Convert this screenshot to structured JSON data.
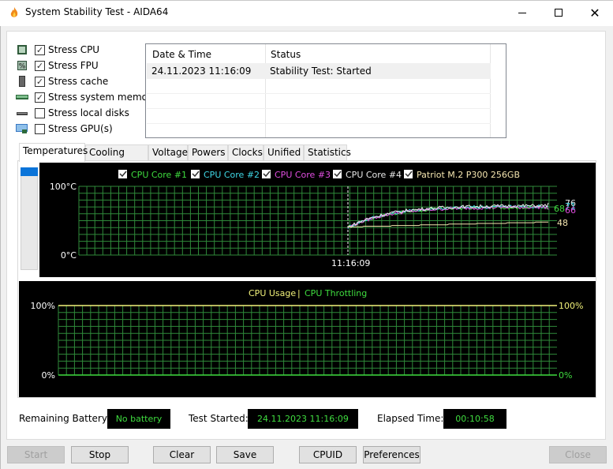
{
  "window": {
    "title": "System Stability Test - AIDA64",
    "controls": {
      "minimize": "—",
      "maximize": "☐",
      "close": "✕"
    }
  },
  "stress_options": [
    {
      "label": "Stress CPU",
      "checked": true,
      "icon": "cpu-icon"
    },
    {
      "label": "Stress FPU",
      "checked": true,
      "icon": "fpu-icon"
    },
    {
      "label": "Stress cache",
      "checked": true,
      "icon": "cache-icon"
    },
    {
      "label": "Stress system memory",
      "checked": true,
      "icon": "memory-icon"
    },
    {
      "label": "Stress local disks",
      "checked": false,
      "icon": "disk-icon"
    },
    {
      "label": "Stress GPU(s)",
      "checked": false,
      "icon": "gpu-icon"
    }
  ],
  "log": {
    "columns": [
      "Date & Time",
      "Status"
    ],
    "rows": [
      {
        "datetime": "24.11.2023 11:16:09",
        "status": "Stability Test: Started"
      }
    ]
  },
  "tabs": [
    "Temperatures",
    "Cooling Fans",
    "Voltages",
    "Powers",
    "Clocks",
    "Unified",
    "Statistics"
  ],
  "active_tab": "Temperatures",
  "chart_data": [
    {
      "type": "line",
      "title": "Temperatures",
      "ylabel": "°C",
      "ylim": [
        0,
        100
      ],
      "ytick_labels": [
        "100°C",
        "0°C"
      ],
      "xtick_labels": [
        "11:16:09"
      ],
      "marker_label": "11:16:09",
      "grid": true,
      "legend": "top",
      "series": [
        {
          "name": "CPU Core #1",
          "color": "#3fdc3f",
          "checked": true,
          "current": 68,
          "start": 40,
          "plateau": 70
        },
        {
          "name": "CPU Core #2",
          "color": "#3fd7e6",
          "checked": true,
          "current": 71,
          "start": 40,
          "plateau": 71
        },
        {
          "name": "CPU Core #3",
          "color": "#e04ee0",
          "checked": true,
          "current": 66,
          "start": 40,
          "plateau": 70
        },
        {
          "name": "CPU Core #4",
          "color": "#e8e8e8",
          "checked": true,
          "current": 76,
          "start": 40,
          "plateau": 72
        },
        {
          "name": "Patriot M.2 P300 256GB",
          "color": "#f5e6b0",
          "checked": true,
          "current": 48,
          "start": 38,
          "plateau": 48
        }
      ],
      "value_labels": [
        {
          "text": "76",
          "color": "#e8e8e8"
        },
        {
          "text": "71",
          "color": "#3fd7e6"
        },
        {
          "text": "68",
          "color": "#3fdc3f"
        },
        {
          "text": "66",
          "color": "#e04ee0"
        },
        {
          "text": "48",
          "color": "#f5e6b0"
        }
      ]
    },
    {
      "type": "line",
      "title": "CPU Usage | CPU Throttling",
      "ylim": [
        0,
        100
      ],
      "ytick_labels_left": [
        "100%",
        "0%"
      ],
      "ytick_labels_right": [
        "100%",
        "0%"
      ],
      "grid": true,
      "legend": "top",
      "series": [
        {
          "name": "CPU Usage",
          "color": "#f2f27a",
          "value": 100
        },
        {
          "name": "CPU Throttling",
          "color": "#3fdc3f",
          "value": 0
        }
      ]
    }
  ],
  "status": {
    "battery_label": "Remaining Battery:",
    "battery_value": "No battery",
    "started_label": "Test Started:",
    "started_value": "24.11.2023 11:16:09",
    "elapsed_label": "Elapsed Time:",
    "elapsed_value": "00:10:58"
  },
  "buttons": {
    "start": "Start",
    "stop": "Stop",
    "clear": "Clear",
    "save": "Save",
    "cpuid": "CPUID",
    "preferences": "Preferences",
    "close": "Close"
  }
}
